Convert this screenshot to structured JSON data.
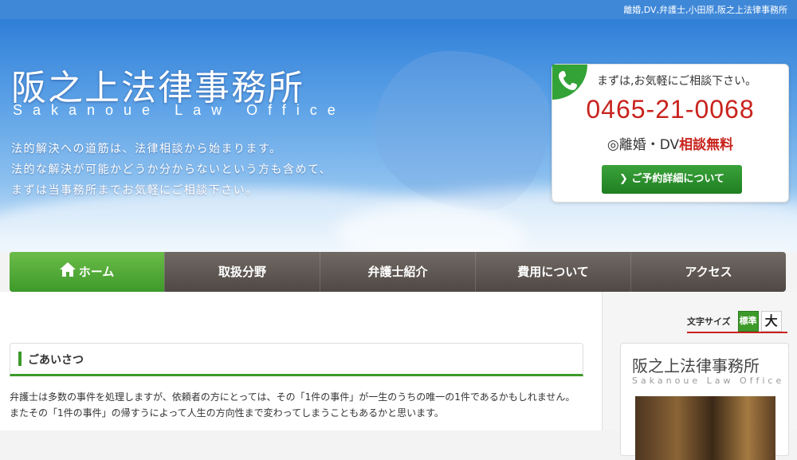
{
  "topbar": {
    "text": "離婚,DV,弁護士,小田原,阪之上法律事務所"
  },
  "hero": {
    "title": "阪之上法律事務所",
    "subtitle": "Sakanoue Law Office",
    "lead": [
      "法的解決への道筋は、法律相談から始まります。",
      "法的な解決が可能かどうか分からないという方も含めて、",
      "まずは当事務所までお気軽にご相談下さい。"
    ]
  },
  "contact": {
    "lead": "まずは,お気軽にご相談下さい。",
    "phone": "0465-21-0068",
    "consult_prefix": "◎離婚・DV",
    "consult_emph": "相談無料",
    "reserve_label": "ご予約詳細について"
  },
  "nav": {
    "items": [
      {
        "label": "ホーム"
      },
      {
        "label": "取扱分野"
      },
      {
        "label": "弁護士紹介"
      },
      {
        "label": "費用について"
      },
      {
        "label": "アクセス"
      }
    ]
  },
  "font_size": {
    "label": "文字サイズ",
    "standard": "標準",
    "large": "大"
  },
  "greeting": {
    "title": "ごあいさつ",
    "paragraphs": [
      "弁護士は多数の事件を処理しますが、依頼者の方にとっては、その「1件の事件」が一生のうちの唯一の1件であるかもしれません。",
      "またその「1件の事件」の帰すうによって人生の方向性まで変わってしまうこともあるかと思います。"
    ]
  },
  "side": {
    "title": "阪之上法律事務所",
    "subtitle": "Sakanoue Law Office"
  },
  "colors": {
    "green": "#3d9a2a",
    "red": "#c8231d",
    "nav": "#5e5752"
  }
}
